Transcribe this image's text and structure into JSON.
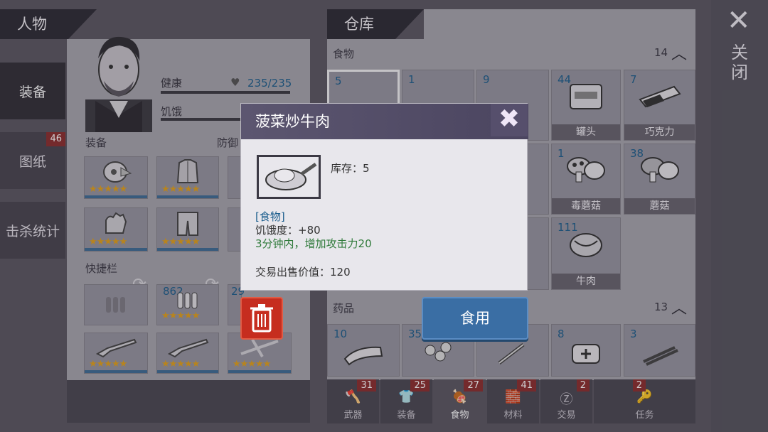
{
  "left_header": "人物",
  "side_tabs": [
    {
      "label": "装备",
      "badge": ""
    },
    {
      "label": "图纸",
      "badge": "46"
    },
    {
      "label": "击杀统计",
      "badge": ""
    }
  ],
  "stats": {
    "health_label": "健康",
    "health_value": "235/235",
    "hunger_label": "饥饿"
  },
  "equip_section": {
    "title": "装备",
    "defense_label": "防御"
  },
  "quickbar_title": "快捷栏",
  "quick_counts": [
    "862",
    "29"
  ],
  "warehouse": {
    "header": "仓库",
    "food_section": "食物",
    "food_count": "14",
    "food_items": [
      {
        "num": "5",
        "cap": ""
      },
      {
        "num": "1",
        "cap": ""
      },
      {
        "num": "9",
        "cap": ""
      },
      {
        "num": "44",
        "cap": "罐头"
      },
      {
        "num": "7",
        "cap": "巧克力"
      },
      {
        "num": "1",
        "cap": "毒蘑菇"
      },
      {
        "num": "38",
        "cap": "蘑菇"
      },
      {
        "num": "111",
        "cap": "牛肉"
      }
    ],
    "medicine_section": "药品",
    "medicine_count": "13",
    "medicine_items": [
      "10",
      "35",
      "8",
      "3"
    ]
  },
  "bottom_tabs": [
    {
      "label": "武器",
      "badge": "31"
    },
    {
      "label": "装备",
      "badge": "25"
    },
    {
      "label": "食物",
      "badge": "27"
    },
    {
      "label": "材料",
      "badge": "41"
    },
    {
      "label": "交易",
      "badge": "2"
    },
    {
      "label": "任务",
      "badge": "2"
    }
  ],
  "close": {
    "icon": "close-icon",
    "label": "关闭"
  },
  "dialog": {
    "title": "菠菜炒牛肉",
    "stock": "库存：5",
    "category": "[食物]",
    "hunger": "饥饿度：+80",
    "effect": "3分钟内，增加攻击力20",
    "sell_price": "交易出售价值：120",
    "eat_label": "食用"
  },
  "colors": {
    "accent_blue": "#3a6ea4",
    "badge_red": "#8c2f2f",
    "trash_red": "#c62d1f",
    "star_gold": "#e3a21c"
  }
}
